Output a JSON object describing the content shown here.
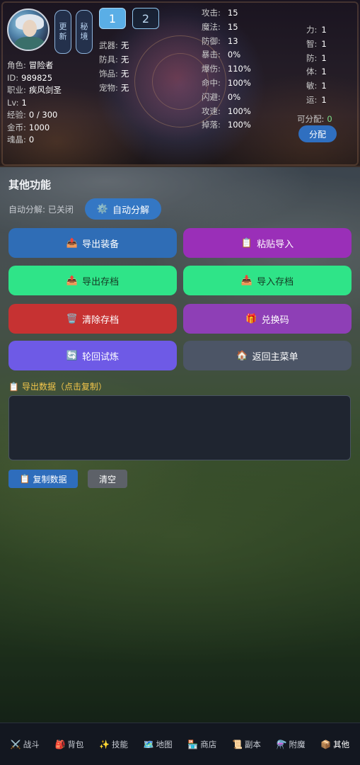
{
  "header": {
    "side_buttons": {
      "update": "更新",
      "secret_realm": "秘境"
    },
    "slots": [
      "1",
      "2"
    ],
    "profile": [
      {
        "key": "角色:",
        "value": "冒险者"
      },
      {
        "key": "ID:",
        "value": "989825"
      },
      {
        "key": "职业:",
        "value": "疾风剑圣"
      },
      {
        "key": "Lv:",
        "value": "1"
      },
      {
        "key": "经验:",
        "value": "0 / 300"
      },
      {
        "key": "金币:",
        "value": "1000"
      },
      {
        "key": "魂晶:",
        "value": "0"
      }
    ],
    "equipment": [
      {
        "key": "武器:",
        "value": "无"
      },
      {
        "key": "防具:",
        "value": "无"
      },
      {
        "key": "饰品:",
        "value": "无"
      },
      {
        "key": "宠物:",
        "value": "无"
      }
    ],
    "combat_stats": [
      {
        "key": "攻击:",
        "value": "15"
      },
      {
        "key": "魔法:",
        "value": "15"
      },
      {
        "key": "防御:",
        "value": "13"
      },
      {
        "key": "暴击:",
        "value": "0%"
      },
      {
        "key": "爆伤:",
        "value": "110%"
      },
      {
        "key": "命中:",
        "value": "100%"
      },
      {
        "key": "闪避:",
        "value": "0%"
      },
      {
        "key": "攻速:",
        "value": "100%"
      },
      {
        "key": "掉落:",
        "value": "100%"
      }
    ],
    "attributes": [
      {
        "key": "力:",
        "value": "1"
      },
      {
        "key": "智:",
        "value": "1"
      },
      {
        "key": "防:",
        "value": "1"
      },
      {
        "key": "体:",
        "value": "1"
      },
      {
        "key": "敏:",
        "value": "1"
      },
      {
        "key": "运:",
        "value": "1"
      }
    ],
    "free_points_label": "可分配:",
    "free_points_value": "0",
    "allocate_button": "分配"
  },
  "other": {
    "title": "其他功能",
    "auto_decompose_status": "自动分解: 已关闭",
    "auto_decompose_button": "自动分解",
    "buttons": {
      "export_equipment": "导出装备",
      "paste_import": "粘贴导入",
      "export_save": "导出存档",
      "import_save": "导入存档",
      "clear_save": "清除存档",
      "redeem_code": "兑换码",
      "reincarnation_trial": "轮回试炼",
      "back_main_menu": "返回主菜单"
    },
    "export_label": "导出数据（点击复制）",
    "export_text": "",
    "copy_button": "复制数据",
    "clear_button": "清空"
  },
  "nav": [
    {
      "label": "战斗",
      "icon": "⚔️"
    },
    {
      "label": "背包",
      "icon": "🎒"
    },
    {
      "label": "技能",
      "icon": "✨"
    },
    {
      "label": "地图",
      "icon": "🗺️"
    },
    {
      "label": "商店",
      "icon": "🏪"
    },
    {
      "label": "副本",
      "icon": "📜"
    },
    {
      "label": "附魔",
      "icon": "⚗️"
    },
    {
      "label": "其他",
      "icon": "📦"
    }
  ],
  "icons": {
    "auto_decompose": "⚙️",
    "export_equipment": "📤",
    "paste_import": "📋",
    "export_save": "📤",
    "import_save": "📥",
    "clear_save": "🗑️",
    "redeem_code": "🎁",
    "reincarnation_trial": "🔄",
    "back_main_menu": "🏠",
    "export_label": "📋",
    "copy": "📋"
  }
}
